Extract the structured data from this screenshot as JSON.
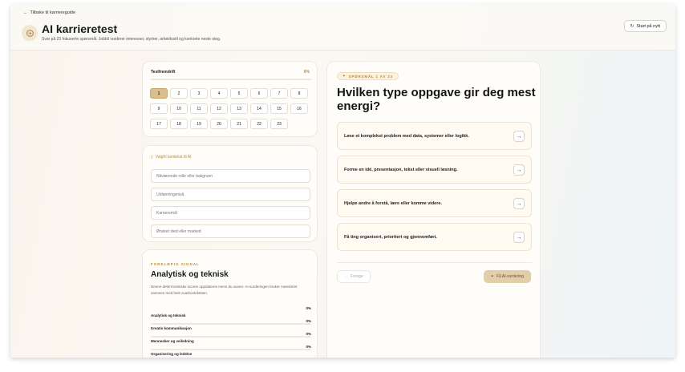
{
  "header": {
    "back_label": "Tilbake til karriereguide",
    "title": "AI karrieretest",
    "subtitle": "Svar på 23 fokuserte spørsmål. Jobbli vurderer interesser, styrker, arbeidsstil og konkrete neste steg.",
    "restart_label": "Start på nytt"
  },
  "progress": {
    "label": "Testfremdrift",
    "percent_text": "0%",
    "percent_value": 0,
    "questions": [
      "1",
      "2",
      "3",
      "4",
      "5",
      "6",
      "7",
      "8",
      "9",
      "10",
      "11",
      "12",
      "13",
      "14",
      "15",
      "16",
      "17",
      "18",
      "19",
      "20",
      "21",
      "22",
      "23"
    ],
    "active_index": 0
  },
  "context": {
    "heading": "Valgfri kontekst til AI",
    "fields": [
      {
        "placeholder": "Nåværende rolle eller bakgrunn"
      },
      {
        "placeholder": "Utdanningsnivå"
      },
      {
        "placeholder": "Karrieremål"
      },
      {
        "placeholder": "Ønsket sted eller marked"
      }
    ]
  },
  "signal": {
    "kicker": "FORELØPIG SIGNAL",
    "title": "Analytisk og teknisk",
    "description": "Denne deterministiske scoren oppdateres mens du svarer. AI-vurderingen bruker mønsteret sammen med hele svarkontektsten.",
    "scores": [
      {
        "name": "Analytisk og teknisk",
        "value": "0%",
        "level": 0
      },
      {
        "name": "Kreativ kommunikasjon",
        "value": "0%",
        "level": 0
      },
      {
        "name": "Mennesker og veiledning",
        "value": "0%",
        "level": 0
      },
      {
        "name": "Organisering og ledelse",
        "value": "0%",
        "level": 0
      }
    ]
  },
  "question": {
    "badge": "SPØRSMÅL 1 AV 23",
    "title": "Hvilken type oppgave gir deg mest energi?",
    "options": [
      {
        "label": "Løse et komplekst problem med data, systemer eller logikk."
      },
      {
        "label": "Forme en idé, presentasjon, tekst eller visuell løsning."
      },
      {
        "label": "Hjelpe andre å forstå, lære eller komme videre."
      },
      {
        "label": "Få ting organisert, prioritert og gjennomført."
      }
    ],
    "prev_label": "Forrige",
    "ai_label": "Få AI-vurdering"
  },
  "colors": {
    "accent": "#b98a3e",
    "active_question": "#d9bf90",
    "ai_button": "#e2cfa9"
  }
}
